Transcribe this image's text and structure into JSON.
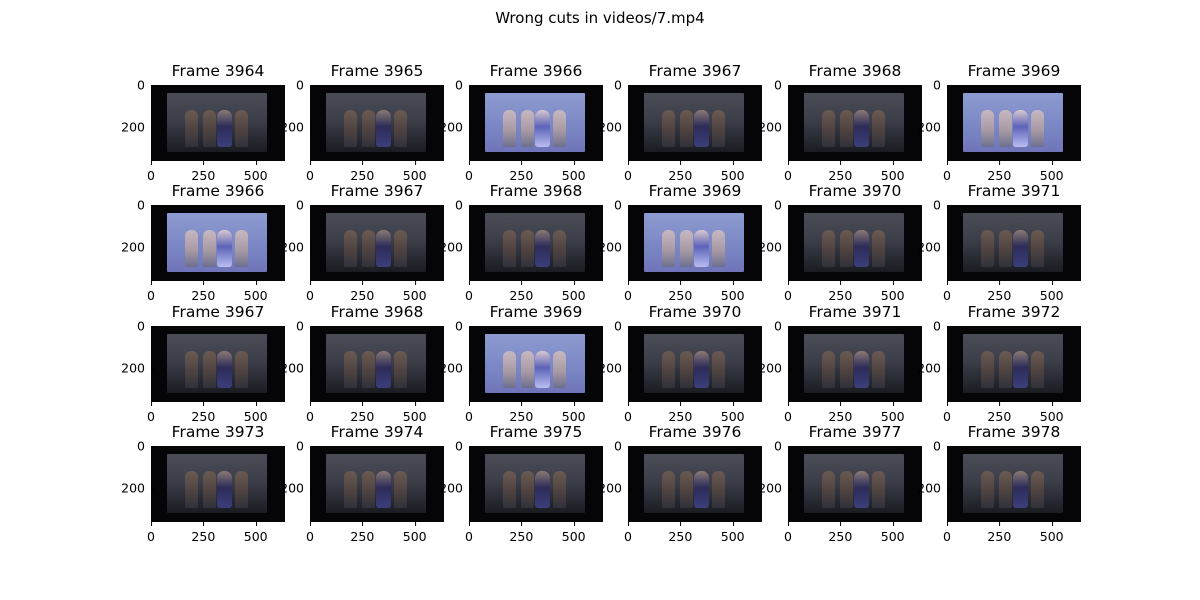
{
  "suptitle": "Wrong cuts in videos/7.mp4",
  "chart_data": {
    "type": "image_grid",
    "title": "Wrong cuts in videos/7.mp4",
    "rows": 4,
    "cols": 6,
    "xticks": [
      0,
      250,
      500
    ],
    "yticks": [
      0,
      200
    ],
    "image_width": 640,
    "image_height": 360,
    "panels": [
      {
        "title": "Frame 3964",
        "tone": "dark"
      },
      {
        "title": "Frame 3965",
        "tone": "dark"
      },
      {
        "title": "Frame 3966",
        "tone": "bright"
      },
      {
        "title": "Frame 3967",
        "tone": "dark"
      },
      {
        "title": "Frame 3968",
        "tone": "dark"
      },
      {
        "title": "Frame 3969",
        "tone": "bright"
      },
      {
        "title": "Frame 3966",
        "tone": "bright"
      },
      {
        "title": "Frame 3967",
        "tone": "dark"
      },
      {
        "title": "Frame 3968",
        "tone": "dark"
      },
      {
        "title": "Frame 3969",
        "tone": "bright"
      },
      {
        "title": "Frame 3970",
        "tone": "dark"
      },
      {
        "title": "Frame 3971",
        "tone": "dark"
      },
      {
        "title": "Frame 3967",
        "tone": "dark"
      },
      {
        "title": "Frame 3968",
        "tone": "dark"
      },
      {
        "title": "Frame 3969",
        "tone": "bright"
      },
      {
        "title": "Frame 3970",
        "tone": "dark"
      },
      {
        "title": "Frame 3971",
        "tone": "dark"
      },
      {
        "title": "Frame 3972",
        "tone": "dark"
      },
      {
        "title": "Frame 3973",
        "tone": "dark"
      },
      {
        "title": "Frame 3974",
        "tone": "dark"
      },
      {
        "title": "Frame 3975",
        "tone": "dark"
      },
      {
        "title": "Frame 3976",
        "tone": "dark"
      },
      {
        "title": "Frame 3977",
        "tone": "dark"
      },
      {
        "title": "Frame 3978",
        "tone": "dark"
      }
    ]
  },
  "colors": {
    "frame_background": "#050507",
    "dark_wall": "#3c3f4a",
    "dark_floor": "#1a1c22",
    "bright_wall": "#8d9bd0",
    "bright_floor": "#6f74b8",
    "figure_dark": "#6b5a52",
    "figure_bright": "#c7b8c2",
    "dress_dark": "#2c2c5a",
    "dress_bright": "#5d63b8"
  }
}
